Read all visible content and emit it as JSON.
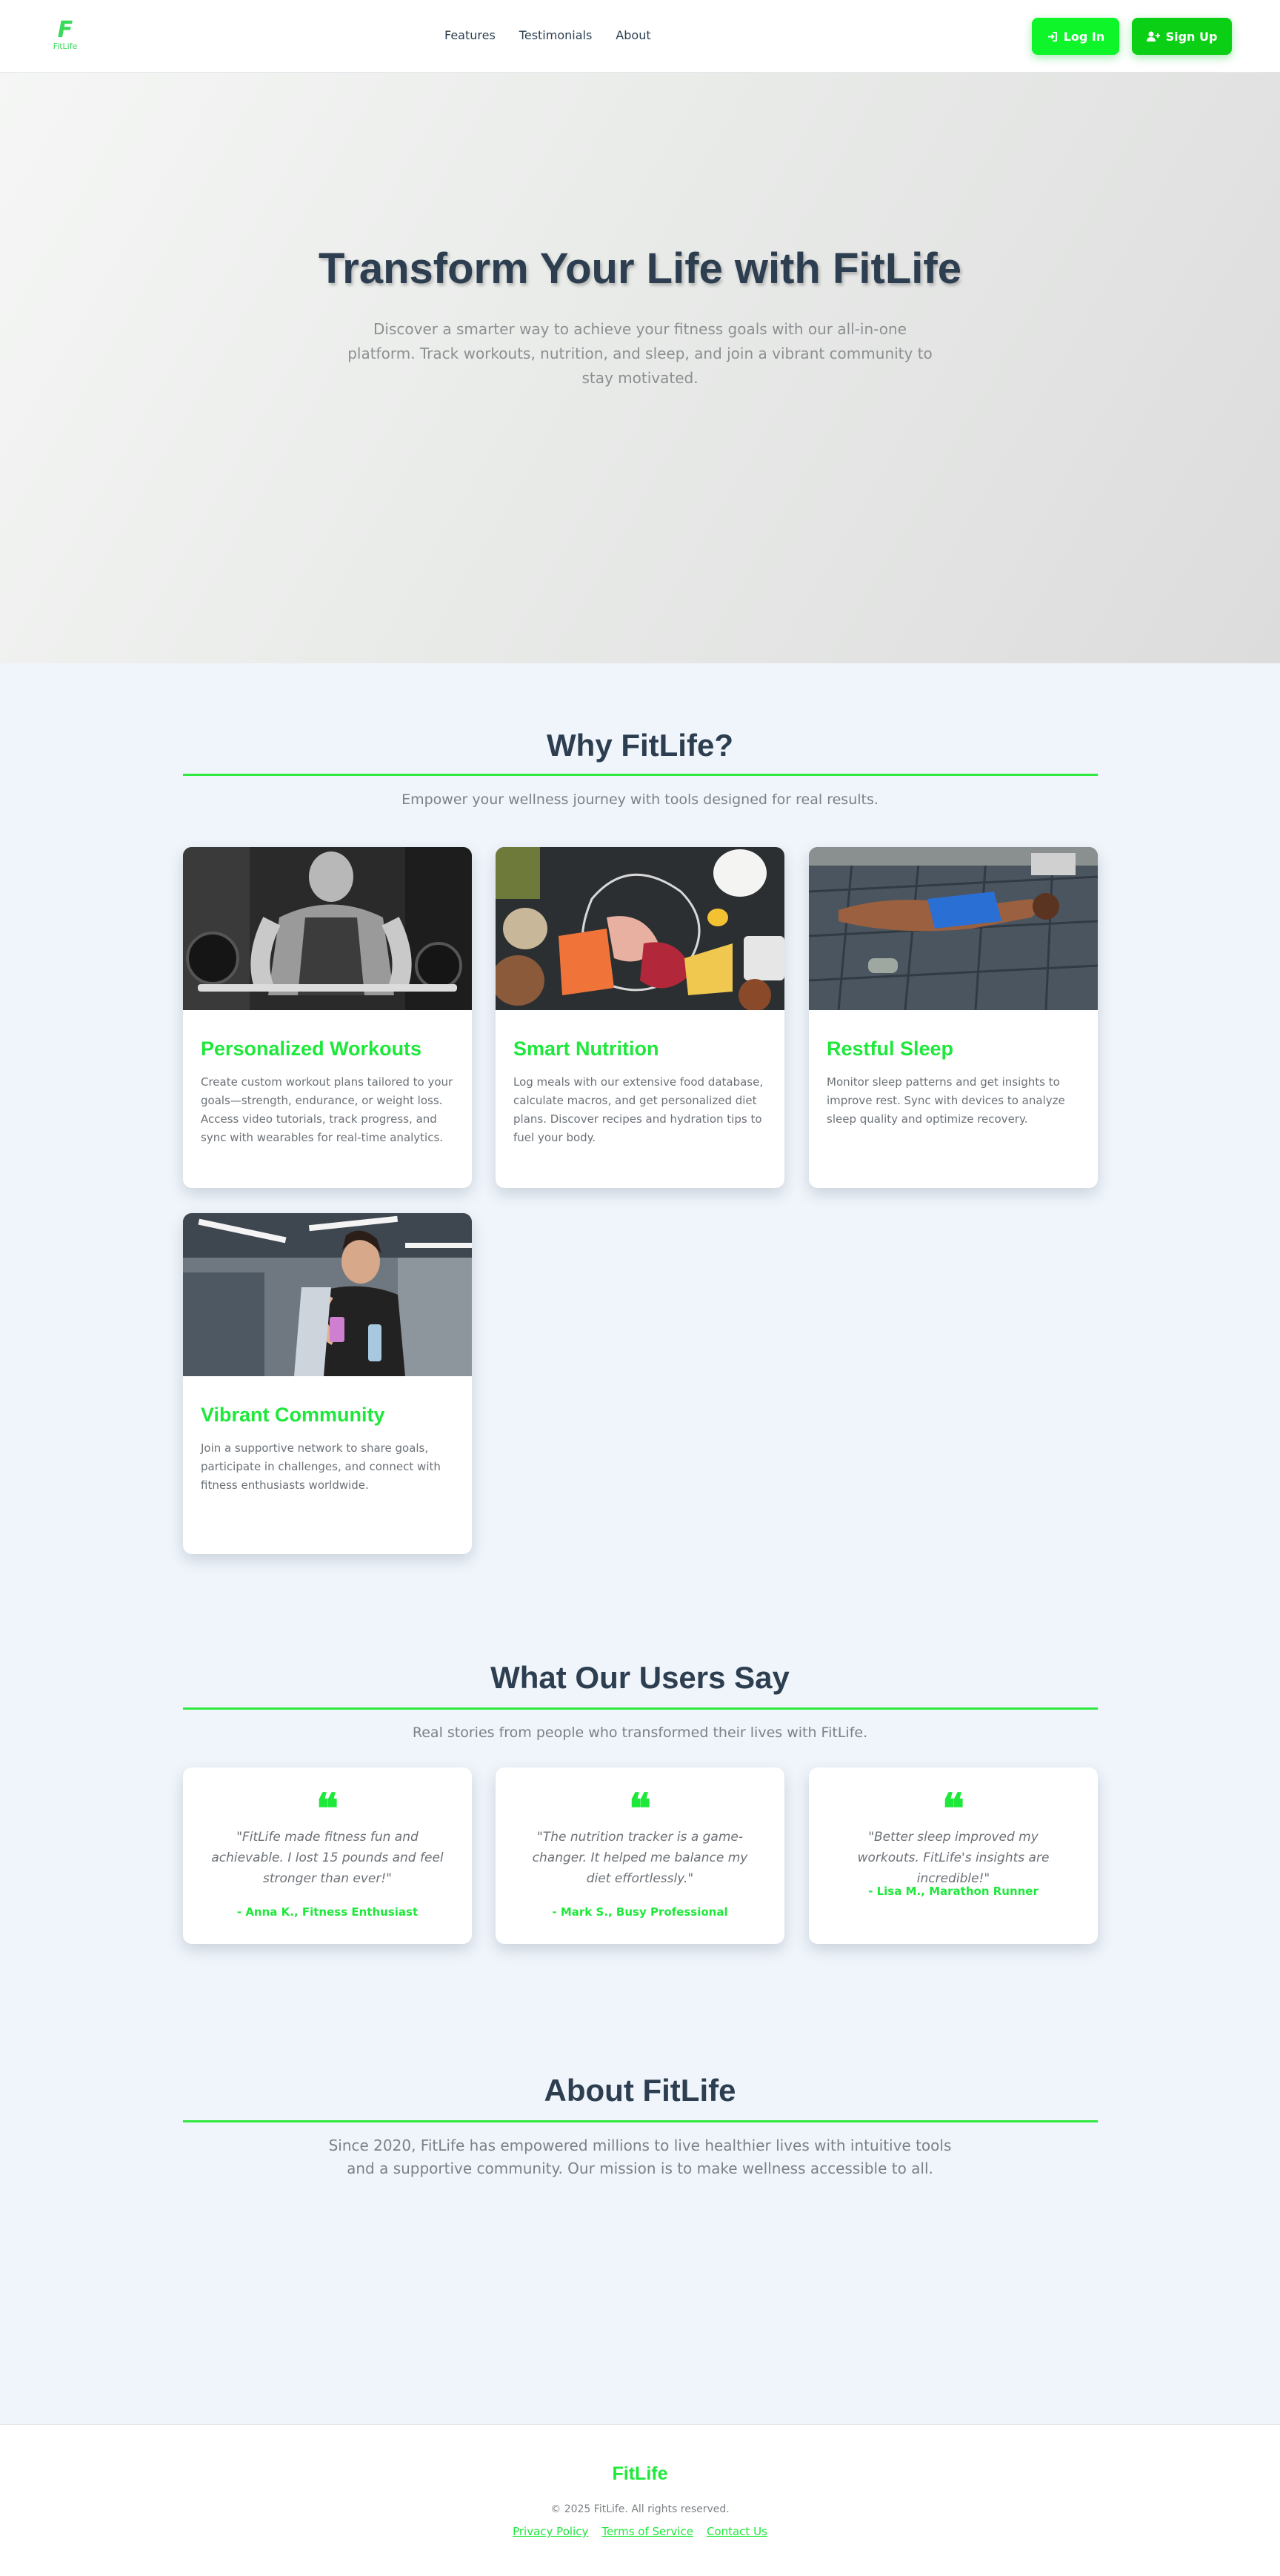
{
  "brand": {
    "logo_mark": "F",
    "logo_text": "FitLife",
    "accent_color": "#1ee83a"
  },
  "nav": {
    "links": [
      {
        "label": "Features"
      },
      {
        "label": "Testimonials"
      },
      {
        "label": "About"
      }
    ],
    "login_label": "Log In",
    "signup_label": "Sign Up",
    "login_icon": "login-arrow-icon",
    "signup_icon": "user-plus-icon"
  },
  "hero": {
    "title": "Transform Your Life with FitLife",
    "subtitle": "Discover a smarter way to achieve your fitness goals with our all-in-one platform. Track workouts, nutrition, and sleep, and join a vibrant community to stay motivated."
  },
  "features": {
    "title": "Why FitLife?",
    "subtitle": "Empower your wellness journey with tools designed for real results.",
    "cards": [
      {
        "title": "Personalized Workouts",
        "description": "Create custom workout plans tailored to your goals—strength, endurance, or weight loss. Access video tutorials, track progress, and sync with wearables for real-time analytics.",
        "image": "weightlifter-photo"
      },
      {
        "title": "Smart Nutrition",
        "description": "Log meals with our extensive food database, calculate macros, and get personalized diet plans. Discover recipes and hydration tips to fuel your body.",
        "image": "healthy-food-photo"
      },
      {
        "title": "Restful Sleep",
        "description": "Monitor sleep patterns and get insights to improve rest. Sync with devices to analyze sleep quality and optimize recovery.",
        "image": "resting-athlete-photo"
      },
      {
        "title": "Vibrant Community",
        "description": "Join a supportive network to share goals, participate in challenges, and connect with fitness enthusiasts worldwide.",
        "image": "woman-with-phone-photo"
      }
    ]
  },
  "testimonials": {
    "title": "What Our Users Say",
    "subtitle": "Real stories from people who transformed their lives with FitLife.",
    "quote_mark": "❝",
    "items": [
      {
        "quote": "\"FitLife made fitness fun and achievable. I lost 15 pounds and feel stronger than ever!\"",
        "author": "- Anna K., Fitness Enthusiast"
      },
      {
        "quote": "\"The nutrition tracker is a game-changer. It helped me balance my diet effortlessly.\"",
        "author": "- Mark S., Busy Professional"
      },
      {
        "quote": "\"Better sleep improved my workouts. FitLife's insights are incredible!\"",
        "author": "- Lisa M., Marathon Runner"
      }
    ]
  },
  "about": {
    "title": "About FitLife",
    "text": "Since 2020, FitLife has empowered millions to live healthier lives with intuitive tools and a supportive community. Our mission is to make wellness accessible to all."
  },
  "footer": {
    "brand": "FitLife",
    "copyright": "© 2025 FitLife. All rights reserved.",
    "links": [
      {
        "label": "Privacy Policy"
      },
      {
        "label": "Terms of Service"
      },
      {
        "label": "Contact Us"
      }
    ]
  }
}
